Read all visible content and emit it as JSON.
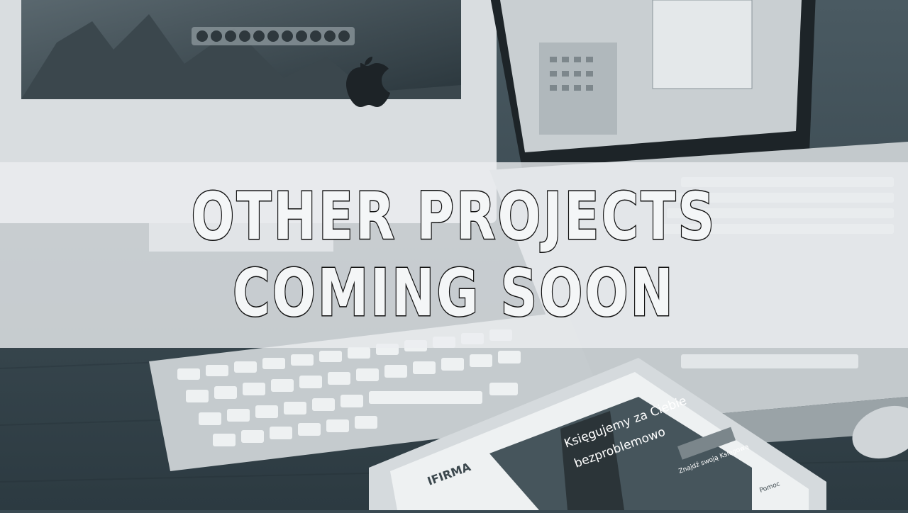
{
  "hero": {
    "line1": "OTHER PROJECTS",
    "line2": "COMING SOON"
  },
  "background": {
    "subject": "desk-with-imac-macbook-keyboard-ipad",
    "tone_color": "#3a4a52"
  },
  "tablet_screen": {
    "brand": "IFIRMA",
    "headline_1": "Księgujemy za Ciebie",
    "headline_2": "bezproblemowo",
    "cta": "Znajdź swoją Księgową",
    "footer_link": "Pomoc"
  },
  "colors": {
    "band": "#ebeef0",
    "text_fill": "#f4f6f7",
    "text_stroke": "#111111"
  }
}
